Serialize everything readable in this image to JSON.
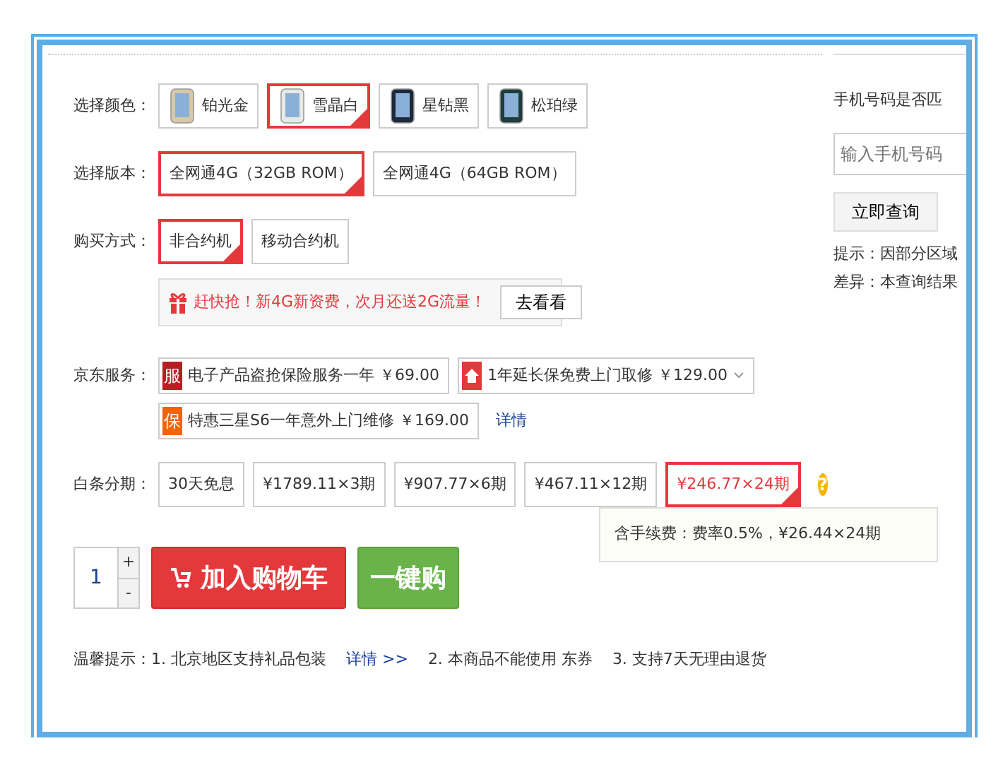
{
  "color_row": {
    "label": "选择颜色：",
    "options": [
      {
        "label": "铂光金",
        "color": "#d8c8a8",
        "selected": false
      },
      {
        "label": "雪晶白",
        "color": "#e8e8e4",
        "selected": true
      },
      {
        "label": "星钻黑",
        "color": "#1e2a3a",
        "selected": false
      },
      {
        "label": "松珀绿",
        "color": "#1f3d3a",
        "selected": false
      }
    ]
  },
  "version_row": {
    "label": "选择版本：",
    "options": [
      {
        "label": "全网通4G（32GB ROM）",
        "selected": true
      },
      {
        "label": "全网通4G（64GB ROM）",
        "selected": false
      }
    ]
  },
  "purchase_row": {
    "label": "购买方式：",
    "options": [
      {
        "label": "非合约机",
        "selected": true
      },
      {
        "label": "移动合约机",
        "selected": false
      }
    ]
  },
  "promo": {
    "text": "赶快抢！新4G新资费，次月还送2G流量！",
    "button": "去看看"
  },
  "service_row": {
    "label": "京东服务：",
    "services": [
      {
        "kind": "char",
        "icon": "服",
        "color": "#b51f24",
        "text": "电子产品盗抢保险服务一年",
        "price": "￥69.00",
        "dropdown": false
      },
      {
        "kind": "house",
        "color": "#e4393c",
        "text": "1年延长保免费上门取修",
        "price": "￥129.00",
        "dropdown": true
      },
      {
        "kind": "char",
        "icon": "保",
        "color": "#f0640a",
        "text": "特惠三星S6一年意外上门维修",
        "price": "￥169.00",
        "dropdown": false
      }
    ],
    "link": "详情"
  },
  "installment_row": {
    "label": "白条分期：",
    "options": [
      {
        "label": "30天免息",
        "selected": false
      },
      {
        "label": "¥1789.11×3期",
        "selected": false
      },
      {
        "label": "¥907.77×6期",
        "selected": false
      },
      {
        "label": "¥467.11×12期",
        "selected": false
      },
      {
        "label": "¥246.77×24期",
        "selected": true
      }
    ],
    "help": "?",
    "tooltip": "含手续费：费率0.5%，¥26.44×24期"
  },
  "quantity": {
    "value": "1",
    "plus": "+",
    "minus": "-"
  },
  "buttons": {
    "cart": "加入购物车",
    "buy": "一键购"
  },
  "tips": {
    "label": "温馨提示：",
    "items": [
      {
        "kind": "text",
        "text": "1. 北京地区支持礼品包装"
      },
      {
        "kind": "link",
        "text": "详情 >>"
      },
      {
        "kind": "text",
        "text": "2. 本商品不能使用 东券"
      },
      {
        "kind": "text",
        "text": "3. 支持7天无理由退货"
      }
    ]
  },
  "phone_panel": {
    "title": "手机号码是否匹",
    "placeholder": "输入手机号码",
    "button": "立即查询",
    "notes": [
      "提示：因部分区域",
      "差异：本查询结果"
    ]
  }
}
